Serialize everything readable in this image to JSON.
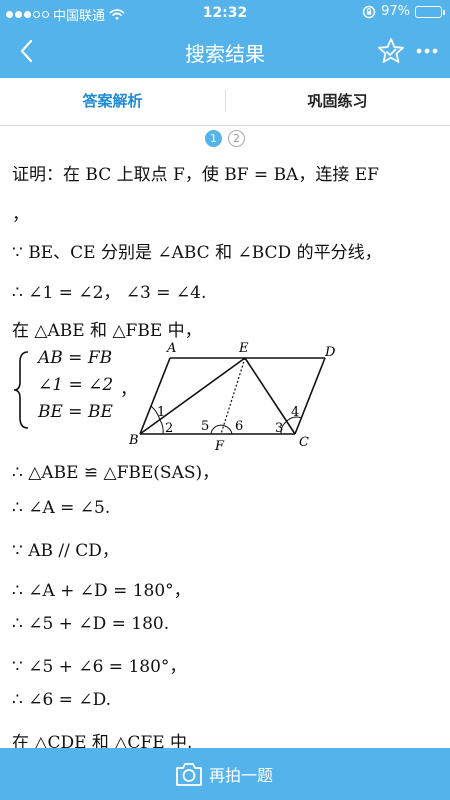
{
  "status_bar": {
    "carrier": "中国联通",
    "time": "12:32",
    "battery": "97%",
    "battery_level": 0.97
  },
  "nav": {
    "title": "搜索结果",
    "back_icon": "chevron-left-icon",
    "favorite_icon": "star-icon",
    "more_icon": "more-horizontal-icon"
  },
  "tabs": [
    {
      "label": "答案解析",
      "active": true
    },
    {
      "label": "巩固练习",
      "active": false
    }
  ],
  "pager": {
    "pages": [
      "1",
      "2"
    ],
    "current": "1"
  },
  "solution": {
    "lines": [
      "证明：在 BC 上取点 F，使 BF = BA，连接 EF",
      "，",
      "∵ BE、CE 分别是 ∠ABC 和 ∠BCD 的平分线，",
      "∴ ∠1 = ∠2，  ∠3 = ∠4.",
      "在 △ABE 和 △FBE 中，"
    ],
    "system": [
      "AB = FB",
      "∠1 = ∠2",
      "BE = BE"
    ],
    "system_comma": "，",
    "after": [
      "∴ △ABE ≌ △FBE(SAS)，",
      "∴ ∠A = ∠5.",
      "∵ AB // CD，",
      "∴ ∠A + ∠D = 180°，",
      "∴ ∠5 + ∠D = 180.",
      "∵ ∠5 + ∠6 = 180°，",
      "∴ ∠6 = ∠D.",
      "在 △CDE 和 △CFE 中."
    ]
  },
  "diagram": {
    "points": {
      "A": "A",
      "E": "E",
      "D": "D",
      "B": "B",
      "F": "F",
      "C": "C"
    },
    "angles": {
      "a1": "1",
      "a2": "2",
      "a3": "3",
      "a4": "4",
      "a5": "5",
      "a6": "6"
    }
  },
  "bottom_bar": {
    "label": "再拍一题",
    "icon": "camera-icon"
  },
  "colors": {
    "accent": "#55b3ec",
    "active_tab": "#1e8bd6"
  }
}
